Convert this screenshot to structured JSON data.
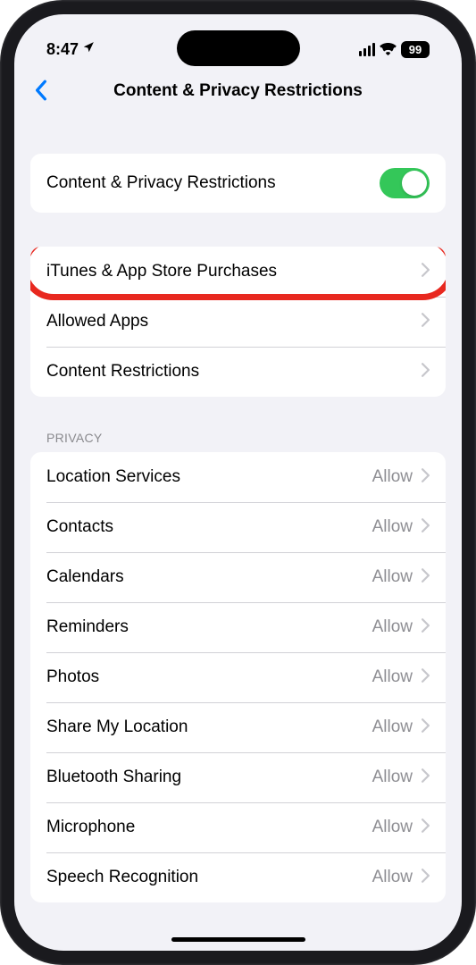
{
  "status": {
    "time": "8:47",
    "battery": "99"
  },
  "nav": {
    "title": "Content & Privacy Restrictions"
  },
  "toggle_row": {
    "label": "Content & Privacy Restrictions"
  },
  "restrict_rows": [
    {
      "label": "iTunes & App Store Purchases"
    },
    {
      "label": "Allowed Apps"
    },
    {
      "label": "Content Restrictions"
    }
  ],
  "privacy": {
    "header": "PRIVACY",
    "rows": [
      {
        "label": "Location Services",
        "value": "Allow"
      },
      {
        "label": "Contacts",
        "value": "Allow"
      },
      {
        "label": "Calendars",
        "value": "Allow"
      },
      {
        "label": "Reminders",
        "value": "Allow"
      },
      {
        "label": "Photos",
        "value": "Allow"
      },
      {
        "label": "Share My Location",
        "value": "Allow"
      },
      {
        "label": "Bluetooth Sharing",
        "value": "Allow"
      },
      {
        "label": "Microphone",
        "value": "Allow"
      },
      {
        "label": "Speech Recognition",
        "value": "Allow"
      }
    ]
  }
}
